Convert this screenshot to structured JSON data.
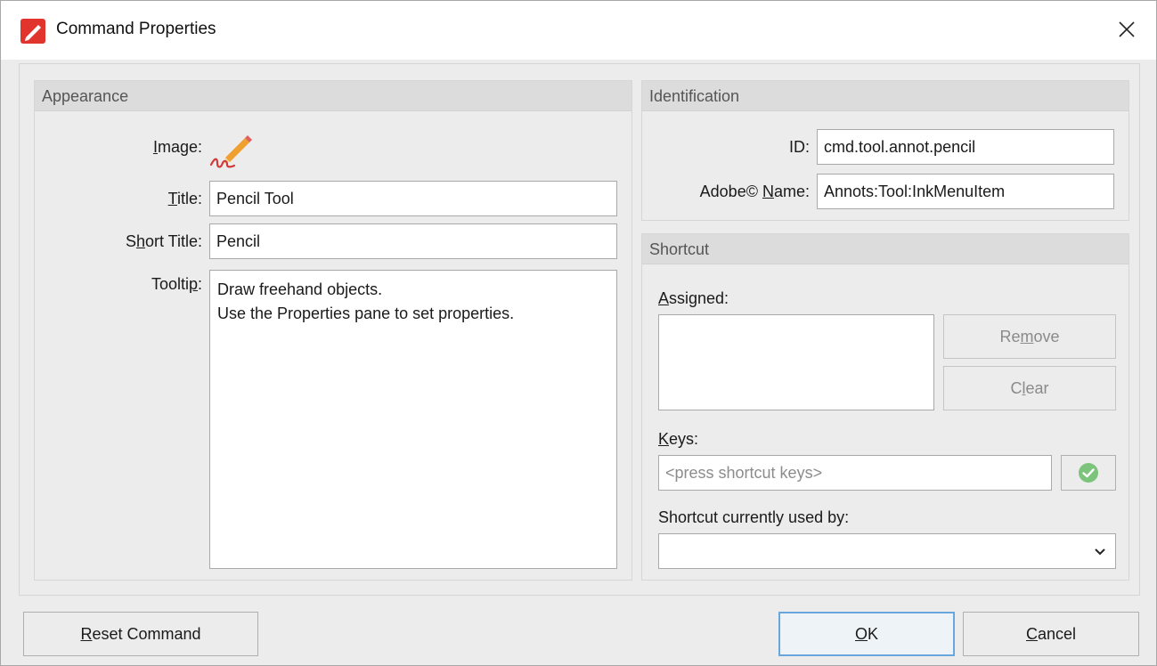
{
  "window": {
    "title": "Command Properties",
    "icon": "pdf-editor-app-icon",
    "close_icon": "close-icon"
  },
  "appearance": {
    "header": "Appearance",
    "image_label_pre": "",
    "image_label_u": "I",
    "image_label_post": "mage:",
    "image_icon": "pencil-signature-icon",
    "title_label_u": "T",
    "title_label_post": "itle:",
    "title_value": "Pencil Tool",
    "short_title_label_pre": "S",
    "short_title_label_u": "h",
    "short_title_label_post": "ort Title:",
    "short_title_value": "Pencil",
    "tooltip_label_pre": "Toolti",
    "tooltip_label_u": "p",
    "tooltip_label_post": ":",
    "tooltip_value": "Draw freehand objects.\nUse the Properties pane to set properties."
  },
  "identification": {
    "header": "Identification",
    "id_label": "ID:",
    "id_value": "cmd.tool.annot.pencil",
    "adobe_label_pre": "Adobe© ",
    "adobe_label_u": "N",
    "adobe_label_post": "ame:",
    "adobe_value": "Annots:Tool:InkMenuItem"
  },
  "shortcut": {
    "header": "Shortcut",
    "assigned_label_u": "A",
    "assigned_label_post": "ssigned:",
    "remove_pre": "Re",
    "remove_u": "m",
    "remove_post": "ove",
    "clear_pre": "C",
    "clear_u": "l",
    "clear_post": "ear",
    "keys_label_u": "K",
    "keys_label_post": "eys:",
    "keys_placeholder": "<press shortcut keys>",
    "confirm_icon": "check-circle-icon",
    "used_by_label": "Shortcut currently used by:",
    "used_by_value": "",
    "chevron_icon": "chevron-down-icon"
  },
  "footer": {
    "reset_u": "R",
    "reset_post": "eset Command",
    "ok_u": "O",
    "ok_post": "K",
    "cancel_u": "C",
    "cancel_post": "ancel"
  },
  "colors": {
    "accent_border": "#6aa6de",
    "check_green": "#7cc47c",
    "pencil_red": "#d23a3a",
    "pencil_orange": "#f0a030"
  }
}
